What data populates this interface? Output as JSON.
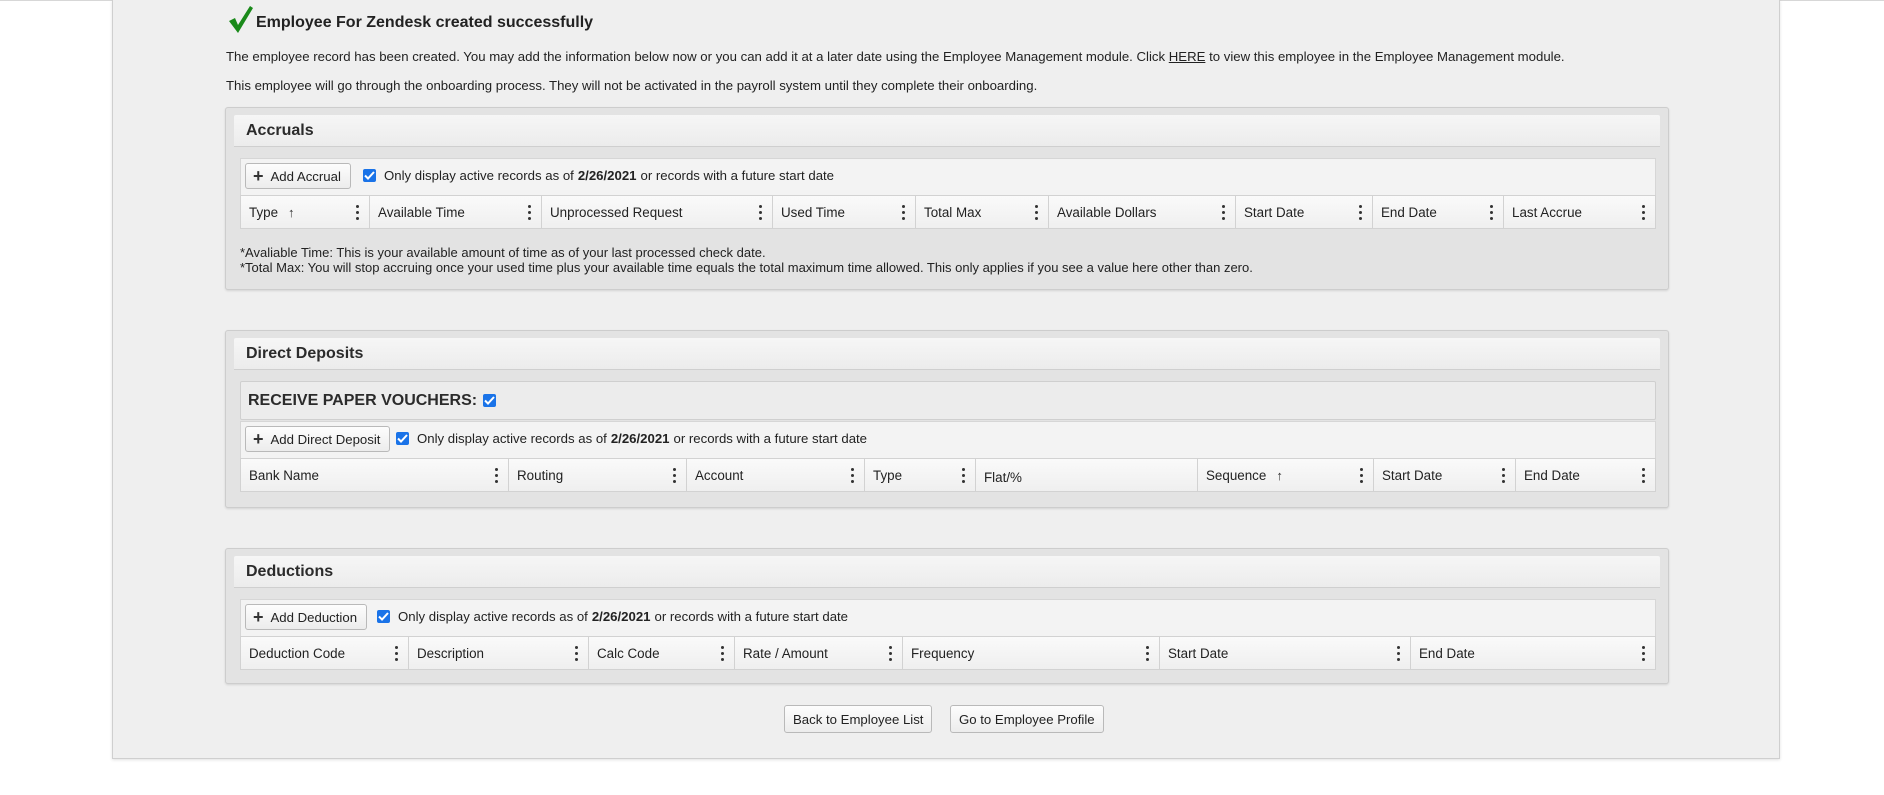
{
  "success": {
    "title": "Employee For Zendesk created successfully",
    "line1_pre": "The employee record has been created. You may add the information below now or you can add it at a later date using the Employee Management module. Click",
    "line1_link": "HERE",
    "line1_post": "to view this employee in the Employee Management module.",
    "line2": "This employee will go through the onboarding process. They will not be activated in the payroll system until they complete their onboarding."
  },
  "filter": {
    "prefix": "Only display active records as of",
    "date": "2/26/2021",
    "suffix": "or records with a future start date"
  },
  "accruals": {
    "title": "Accruals",
    "add_label": "Add Accrual",
    "filter_checked": true,
    "columns": [
      "Type",
      "Available Time",
      "Unprocessed Request",
      "Used Time",
      "Total Max",
      "Available Dollars",
      "Start Date",
      "End Date",
      "Last Accrue"
    ],
    "sorted_column": "Type",
    "note1": "*Avaliable Time: This is your available amount of time as of your last processed check date.",
    "note2": "*Total Max: You will stop accruing once your used time plus your available time equals the total maximum time allowed. This only applies if you see a value here other than zero."
  },
  "direct_deposits": {
    "title": "Direct Deposits",
    "voucher_label": "RECEIVE PAPER VOUCHERS:",
    "voucher_checked": true,
    "add_label": "Add Direct Deposit",
    "filter_checked": true,
    "columns": [
      "Bank Name",
      "Routing",
      "Account",
      "Type",
      "Flat/%",
      "Sequence",
      "Start Date",
      "End Date"
    ],
    "sorted_column": "Sequence"
  },
  "deductions": {
    "title": "Deductions",
    "add_label": "Add Deduction",
    "filter_checked": true,
    "columns": [
      "Deduction Code",
      "Description",
      "Calc Code",
      "Rate / Amount",
      "Frequency",
      "Start Date",
      "End Date"
    ]
  },
  "footer": {
    "back_label": "Back to Employee List",
    "profile_label": "Go to Employee Profile"
  },
  "colors": {
    "check": "#1a8a1a",
    "checkbox": "#1a73e8"
  },
  "icons": {
    "success": "checkmark-icon",
    "add": "plus-icon",
    "sort": "sort-ascending-icon",
    "menu": "kebab-menu-icon"
  }
}
